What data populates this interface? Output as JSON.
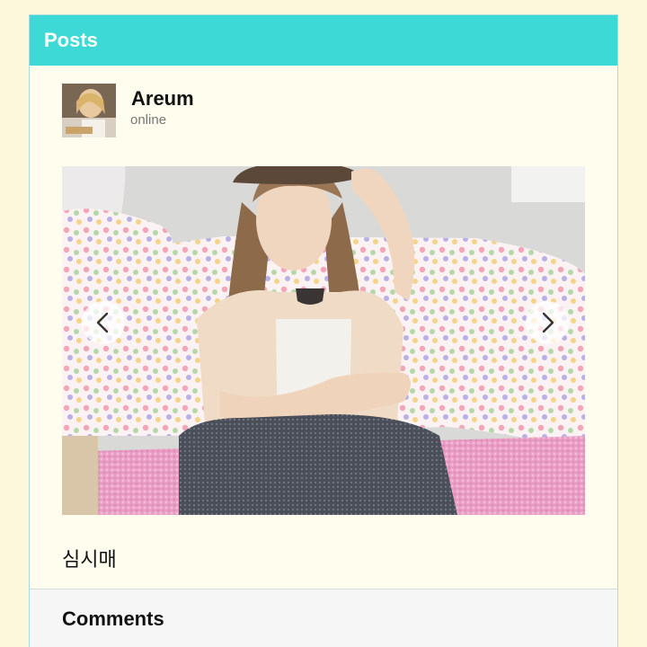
{
  "header": {
    "title": "Posts"
  },
  "post": {
    "author": {
      "name": "Areum",
      "status": "online",
      "avatar_icon": "user-photo-avatar"
    },
    "photo": {
      "description_icon": "post-photo",
      "current": 1
    },
    "caption": "심시매",
    "nav": {
      "prev_icon": "chevron-left-icon",
      "next_icon": "chevron-right-icon"
    }
  },
  "comments": {
    "title": "Comments"
  },
  "colors": {
    "accent": "#3dd9d6",
    "background": "#fdf8dc",
    "card": "#fffeee"
  }
}
